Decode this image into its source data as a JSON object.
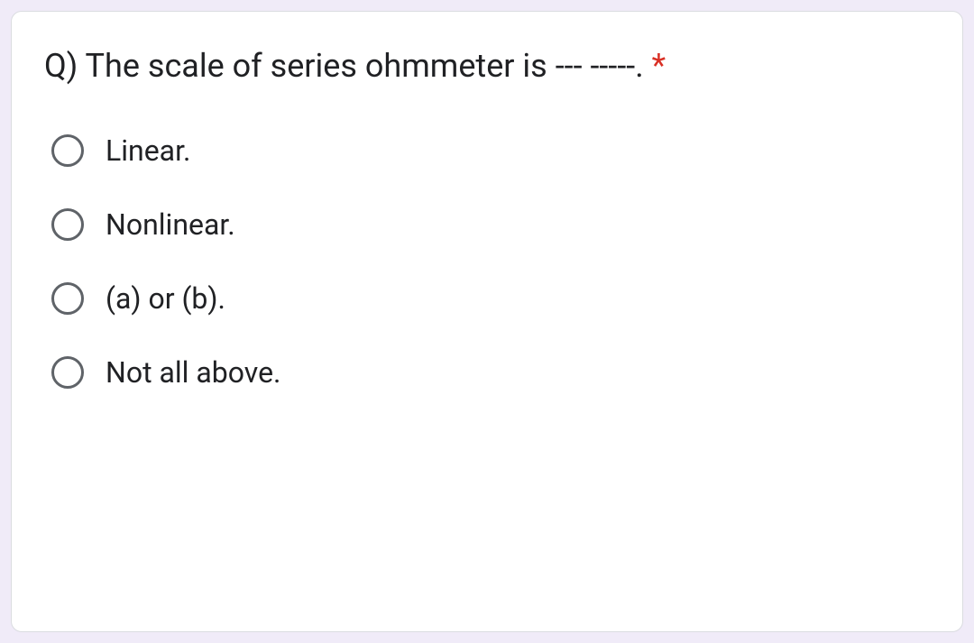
{
  "question": {
    "prefix": "Q) ",
    "text": "The scale of series ohmmeter is --- -----.",
    "required_marker": " *"
  },
  "options": [
    {
      "label": "Linear."
    },
    {
      "label": "Nonlinear."
    },
    {
      "label": "(a) or (b)."
    },
    {
      "label": "Not all above."
    }
  ]
}
